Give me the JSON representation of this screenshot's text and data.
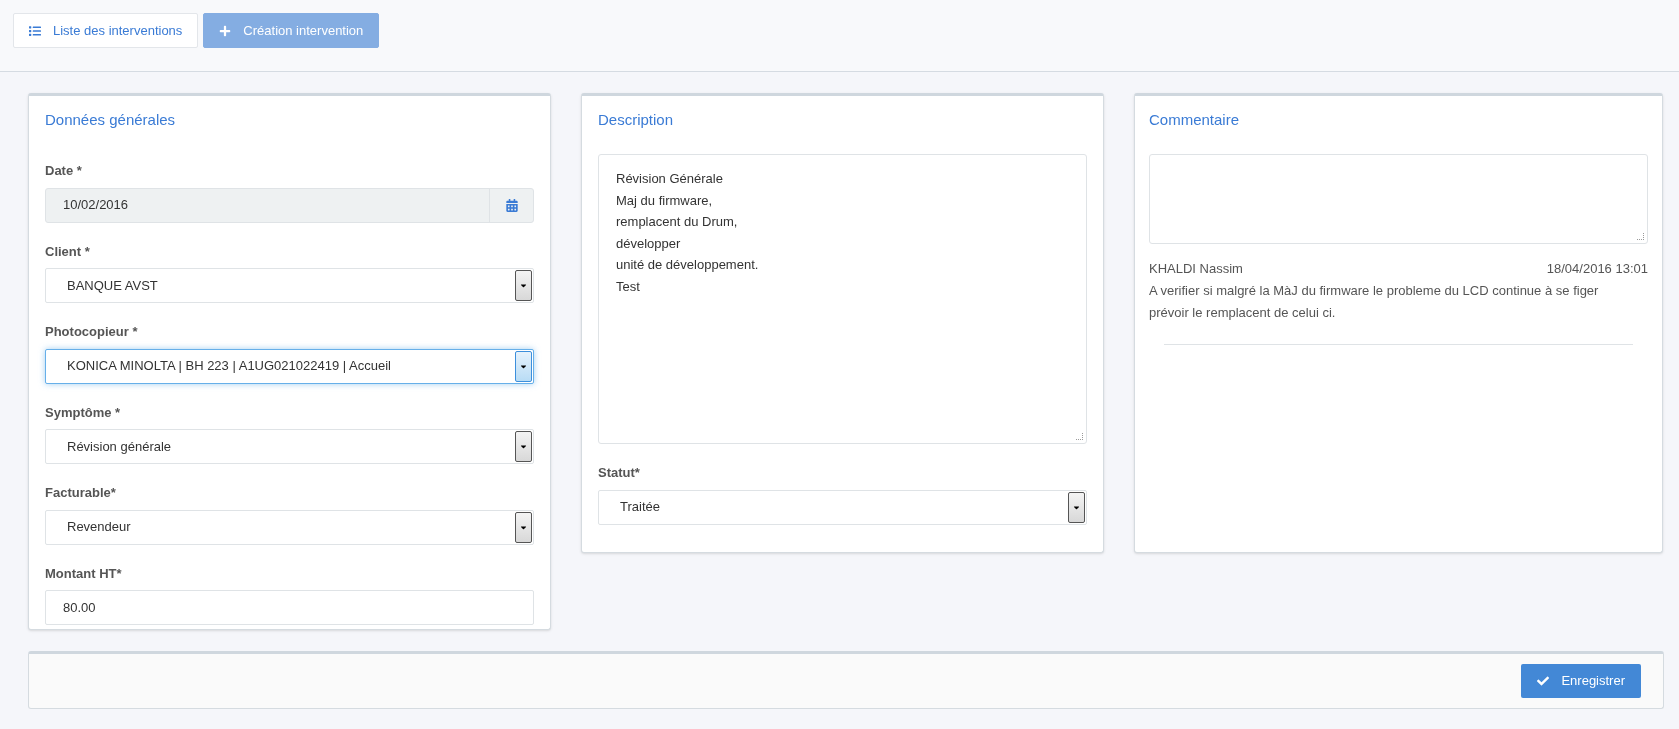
{
  "toolbar": {
    "buttons": [
      {
        "kind": "list",
        "label": "Liste des interventions",
        "disabled": false
      },
      {
        "kind": "add",
        "label": "Création intervention",
        "disabled": true
      }
    ]
  },
  "general": {
    "title": "Données générales",
    "fields": [
      {
        "kind": "date",
        "label": "Date *",
        "value": "10/02/2016",
        "readonly": true,
        "focused": false
      },
      {
        "kind": "select",
        "label": "Client *",
        "value": "BANQUE AVST",
        "readonly": false,
        "focused": false
      },
      {
        "kind": "select",
        "label": "Photocopieur *",
        "value": "KONICA MINOLTA | BH 223 | A1UG021022419 | Accueil",
        "readonly": false,
        "focused": true
      },
      {
        "kind": "select",
        "label": "Symptôme *",
        "value": "Révision générale",
        "readonly": false,
        "focused": false
      },
      {
        "kind": "select",
        "label": "Facturable*",
        "value": "Revendeur",
        "readonly": false,
        "focused": false
      },
      {
        "kind": "text",
        "label": "Montant HT*",
        "value": "80.00",
        "readonly": false,
        "focused": false
      }
    ]
  },
  "description": {
    "title": "Description",
    "value": "Révision Générale\nMaj du firmware,\nremplacent du Drum,\ndévelopper\nunité de développement.\nTest",
    "status": {
      "label": "Statut*",
      "value": "Traitée"
    }
  },
  "comments": {
    "title": "Commentaire",
    "items": [
      {
        "author": "KHALDI Nassim",
        "time": "18/04/2016 13:01",
        "text": "A verifier si malgré la MàJ du firmware le probleme du LCD continue à se figer\nprévoir le remplacent de celui ci."
      }
    ]
  },
  "footer": {
    "save_label": "Enregistrer"
  }
}
